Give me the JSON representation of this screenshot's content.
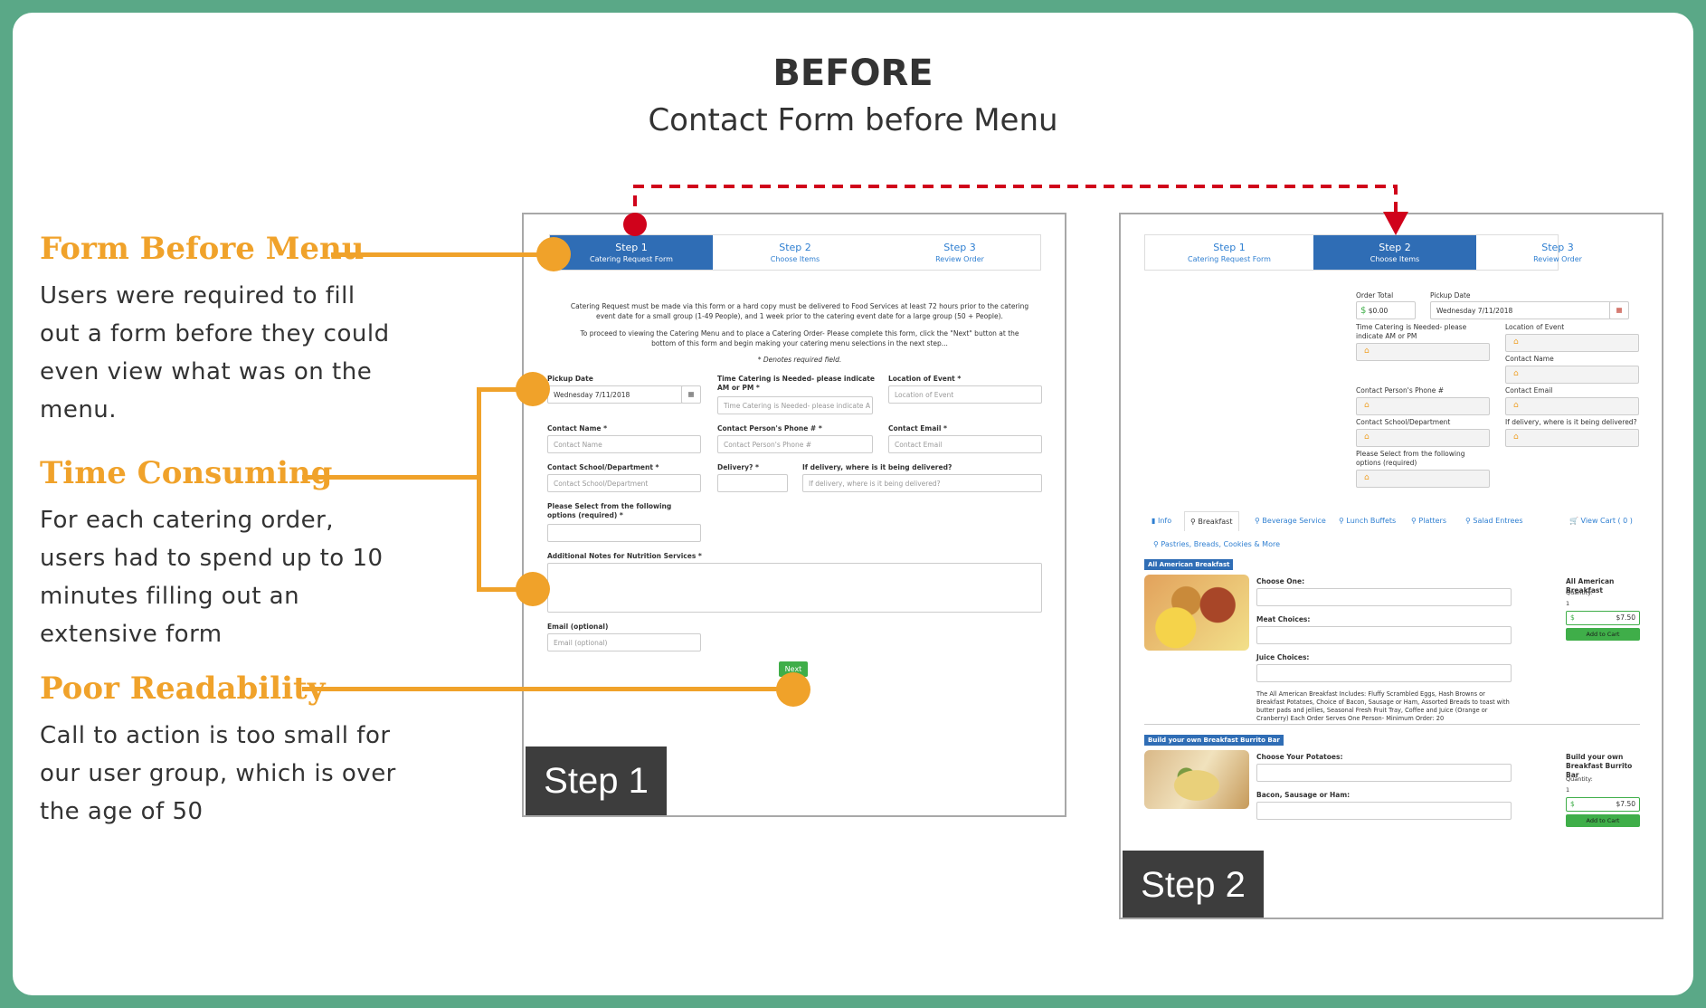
{
  "header": {
    "title": "BEFORE",
    "subtitle": "Contact Form before Menu"
  },
  "annotations": [
    {
      "title": "Form Before Menu",
      "body": "Users were required to fill out a form before they could even view what was on the menu."
    },
    {
      "title": "Time Consuming",
      "body": "For each catering order, users had to spend up to 10 minutes filling out an extensive form"
    },
    {
      "title": "Poor Readability",
      "body": "Call to action is too small for our user group, which is over the age of 50"
    }
  ],
  "steps": [
    {
      "title": "Step 1",
      "sub": "Catering Request Form"
    },
    {
      "title": "Step 2",
      "sub": "Choose Items"
    },
    {
      "title": "Step 3",
      "sub": "Review Order"
    }
  ],
  "step1": {
    "badge": "Step 1",
    "intro1": "Catering  Request must be made via this form or a hard copy must be delivered to Food Services at least 72 hours prior to the catering event date for a small group (1-49 People), and 1 week prior to the catering event date for a large group (50 + People).",
    "intro2": "To proceed to viewing the Catering Menu and to place a Catering Order-  Please complete this form, click the \"Next\"  button at the bottom of this form and begin making your catering menu selections in the next step...",
    "required_note": "* Denotes required field.",
    "fields": {
      "pickup_date": {
        "label": "Pickup Date",
        "value": "Wednesday 7/11/2018"
      },
      "time_needed": {
        "label": "Time Catering is Needed- please indicate AM or PM *",
        "placeholder": "Time Catering is Needed- please indicate A"
      },
      "location": {
        "label": "Location of Event *",
        "placeholder": "Location of Event"
      },
      "contact_name": {
        "label": "Contact Name *",
        "placeholder": "Contact Name"
      },
      "contact_phone": {
        "label": "Contact Person's Phone # *",
        "placeholder": "Contact Person's Phone #"
      },
      "contact_email": {
        "label": "Contact Email *",
        "placeholder": "Contact Email"
      },
      "school": {
        "label": "Contact School/Department *",
        "placeholder": "Contact School/Department"
      },
      "delivery": {
        "label": "Delivery? *"
      },
      "delivery_where": {
        "label": "If delivery, where is it being delivered?",
        "placeholder": "If delivery, where is it being delivered?"
      },
      "options": {
        "label": "Please Select from the following options (required) *"
      },
      "notes": {
        "label": "Additional Notes for Nutrition Services *"
      },
      "email": {
        "label": "Email (optional)",
        "placeholder": "Email (optional)"
      }
    },
    "next_label": "Next"
  },
  "step2": {
    "badge": "Step 2",
    "order_total_label": "Order Total",
    "order_total": "$0.00",
    "currency": "$",
    "pickup_label": "Pickup Date",
    "pickup_value": "Wednesday 7/11/2018",
    "time_label": "Time Catering is Needed- please indicate AM or PM",
    "location_label": "Location of Event",
    "contact_name_label": "Contact Name",
    "phone_label": "Contact Person's Phone #",
    "email_label": "Contact Email",
    "school_label": "Contact School/Department",
    "delivery_label": "If delivery, where is it being delivered?",
    "options_label": "Please Select from the following options (required)",
    "tabs": [
      "Info",
      "Breakfast",
      "Beverage Service",
      "Lunch Buffets",
      "Platters",
      "Salad Entrees",
      "View Cart ( 0 )",
      "Pastries, Breads, Cookies & More"
    ],
    "items": [
      {
        "section": "All American Breakfast",
        "fields": [
          "Choose One:",
          "Meat Choices:",
          "Juice Choices:"
        ],
        "desc": "The All American Breakfast Includes: Fluffy Scrambled Eggs, Hash Browns or Breakfast Potatoes, Choice of Bacon, Sausage or Ham, Assorted Breads to toast with butter pads and jellies, Seasonal Fresh Fruit Tray, Coffee and Juice (Orange or Cranberry) Each Order Serves One Person- Minimum Order: 20",
        "name": "All American Breakfast",
        "qty_label": "Quantity:",
        "qty": "1",
        "price": "$7.50",
        "add": "Add to Cart"
      },
      {
        "section": "Build your own Breakfast Burrito Bar",
        "fields": [
          "Choose Your Potatoes:",
          "Bacon, Sausage or Ham:"
        ],
        "name": "Build your own Breakfast Burrito Bar",
        "qty_label": "Quantity:",
        "qty": "1",
        "price": "$7.50",
        "add": "Add to Cart"
      }
    ]
  },
  "colors": {
    "accent": "#f0a22a",
    "frame": "#5aa887",
    "arrow": "#d0021b",
    "step_active": "#2f6db5",
    "button": "#3fae49"
  },
  "icons": [
    "calendar-icon",
    "home-icon",
    "cart-icon",
    "arrow-down-icon"
  ]
}
